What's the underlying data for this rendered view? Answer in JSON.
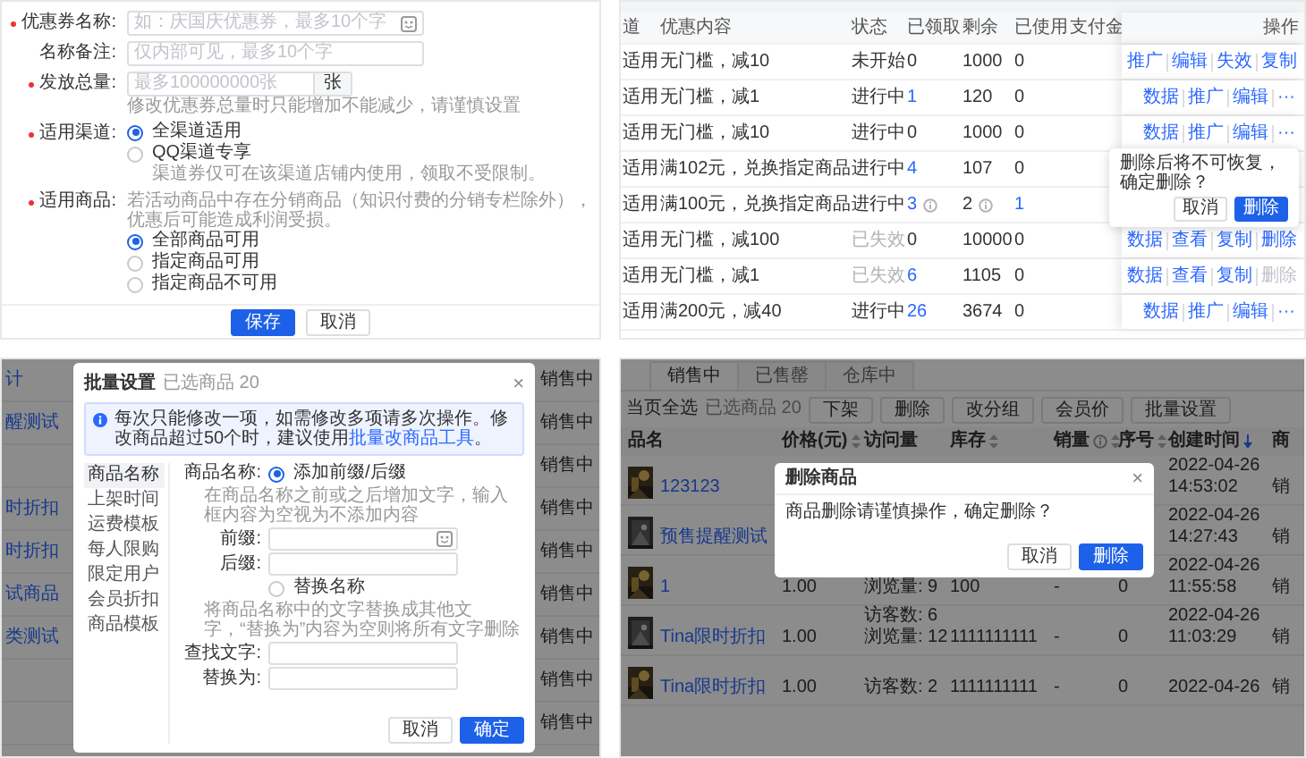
{
  "coupon_form": {
    "fields": [
      {
        "kind": "input",
        "label": "优惠券名称:",
        "required": true,
        "placeholder": "如：庆国庆优惠券，最多10个字",
        "emoji": true
      },
      {
        "kind": "input",
        "label": "名称备注:",
        "required": false,
        "placeholder": "仅内部可见，最多10个字",
        "emoji": false
      },
      {
        "kind": "addon_input",
        "label": "发放总量:",
        "required": true,
        "placeholder": "最多100000000张",
        "addon": "张",
        "hint": "修改优惠券总量时只能增加不能减少，请谨慎设置"
      },
      {
        "kind": "radio",
        "label": "适用渠道:",
        "required": true,
        "options": [
          {
            "label": "全渠道适用",
            "selected": true
          },
          {
            "label": "QQ渠道专享",
            "selected": false,
            "hint": "渠道券仅可在该渠道店铺内使用，领取不受限制。"
          }
        ]
      },
      {
        "kind": "radio",
        "label": "适用商品:",
        "required": true,
        "hint": "若活动商品中存在分销商品（知识付费的分销专栏除外），优惠后可能造成利润受损。",
        "options": [
          {
            "label": "全部商品可用",
            "selected": true
          },
          {
            "label": "指定商品可用",
            "selected": false
          },
          {
            "label": "指定商品不可用",
            "selected": false
          }
        ]
      }
    ],
    "buttons": [
      {
        "label": "保存",
        "primary": true
      },
      {
        "label": "取消",
        "primary": false
      }
    ]
  },
  "coupon_table": {
    "columns": [
      "道",
      "优惠内容",
      "状态",
      "已领取",
      "剩余",
      "已使用",
      "支付金",
      "操作"
    ],
    "rows": [
      {
        "cells": [
          {
            "kind": "plain",
            "text": "适用"
          },
          {
            "kind": "plain",
            "text": "无门槛，减10"
          },
          {
            "kind": "plain",
            "text": "未开始"
          },
          {
            "kind": "plain",
            "text": "0"
          },
          {
            "kind": "plain",
            "text": "1000"
          },
          {
            "kind": "plain",
            "text": "0"
          }
        ],
        "actions": [
          {
            "label": "推广",
            "disabled": false
          },
          {
            "label": "编辑",
            "disabled": false
          },
          {
            "label": "失效",
            "disabled": false
          },
          {
            "label": "复制",
            "disabled": false
          }
        ]
      },
      {
        "cells": [
          {
            "kind": "plain",
            "text": "适用"
          },
          {
            "kind": "plain",
            "text": "无门槛，减1"
          },
          {
            "kind": "plain",
            "text": "进行中"
          },
          {
            "kind": "link",
            "text": "1"
          },
          {
            "kind": "plain",
            "text": "120"
          },
          {
            "kind": "plain",
            "text": "0"
          }
        ],
        "actions": [
          {
            "label": "数据",
            "disabled": false
          },
          {
            "label": "推广",
            "disabled": false
          },
          {
            "label": "编辑",
            "disabled": false
          },
          {
            "label": "···",
            "disabled": false
          }
        ]
      },
      {
        "cells": [
          {
            "kind": "plain",
            "text": "适用"
          },
          {
            "kind": "plain",
            "text": "无门槛，减10"
          },
          {
            "kind": "plain",
            "text": "进行中"
          },
          {
            "kind": "plain",
            "text": "0"
          },
          {
            "kind": "plain",
            "text": "1000"
          },
          {
            "kind": "plain",
            "text": "0"
          }
        ],
        "actions": [
          {
            "label": "数据",
            "disabled": false
          },
          {
            "label": "推广",
            "disabled": false
          },
          {
            "label": "编辑",
            "disabled": false
          },
          {
            "label": "···",
            "disabled": false
          }
        ]
      },
      {
        "cells": [
          {
            "kind": "plain",
            "text": "适用"
          },
          {
            "kind": "plain",
            "text": "满102元，兑换指定商品"
          },
          {
            "kind": "plain",
            "text": "进行中"
          },
          {
            "kind": "link",
            "text": "4"
          },
          {
            "kind": "plain",
            "text": "107"
          },
          {
            "kind": "plain",
            "text": "0"
          }
        ]
      },
      {
        "cells": [
          {
            "kind": "plain",
            "text": "适用"
          },
          {
            "kind": "plain",
            "text": "满100元，兑换指定商品"
          },
          {
            "kind": "plain",
            "text": "进行中"
          },
          {
            "kind": "link_info",
            "text": "3"
          },
          {
            "kind": "plain_info",
            "text": "2"
          },
          {
            "kind": "link",
            "text": "1"
          }
        ]
      },
      {
        "cells": [
          {
            "kind": "plain",
            "text": "适用"
          },
          {
            "kind": "plain",
            "text": "无门槛，减100"
          },
          {
            "kind": "muted",
            "text": "已失效"
          },
          {
            "kind": "plain",
            "text": "0"
          },
          {
            "kind": "plain",
            "text": "10000"
          },
          {
            "kind": "plain",
            "text": "0"
          }
        ],
        "actions": [
          {
            "label": "数据",
            "disabled": false
          },
          {
            "label": "查看",
            "disabled": false
          },
          {
            "label": "复制",
            "disabled": false
          },
          {
            "label": "删除",
            "disabled": false
          }
        ]
      },
      {
        "cells": [
          {
            "kind": "plain",
            "text": "适用"
          },
          {
            "kind": "plain",
            "text": "无门槛，减1"
          },
          {
            "kind": "muted",
            "text": "已失效"
          },
          {
            "kind": "link",
            "text": "6"
          },
          {
            "kind": "plain",
            "text": "1105"
          },
          {
            "kind": "plain",
            "text": "0"
          }
        ],
        "actions": [
          {
            "label": "数据",
            "disabled": false
          },
          {
            "label": "查看",
            "disabled": false
          },
          {
            "label": "复制",
            "disabled": false
          },
          {
            "label": "删除",
            "disabled": true
          }
        ]
      },
      {
        "cells": [
          {
            "kind": "plain",
            "text": "适用"
          },
          {
            "kind": "plain",
            "text": "满200元，减40"
          },
          {
            "kind": "plain",
            "text": "进行中"
          },
          {
            "kind": "link",
            "text": "26"
          },
          {
            "kind": "plain",
            "text": "3674"
          },
          {
            "kind": "plain",
            "text": "0"
          }
        ],
        "actions": [
          {
            "label": "数据",
            "disabled": false
          },
          {
            "label": "推广",
            "disabled": false
          },
          {
            "label": "编辑",
            "disabled": false
          },
          {
            "label": "···",
            "disabled": false
          }
        ]
      }
    ],
    "popconfirm": {
      "message": "删除后将不可恢复，确定删除？",
      "buttons": [
        {
          "label": "取消",
          "primary": false
        },
        {
          "label": "删除",
          "primary": true
        }
      ]
    }
  },
  "batch_panel": {
    "background_rows": [
      {
        "name": "计",
        "status": "销售中"
      },
      {
        "name": "醒测试",
        "status": "销售中"
      },
      {
        "status": "销售中"
      },
      {
        "name": "时折扣",
        "status": "销售中"
      },
      {
        "name": "时折扣",
        "status": "销售中"
      },
      {
        "name": "试商品",
        "status": "销售中"
      },
      {
        "name": "类测试",
        "status": "销售中"
      },
      {
        "status": "销售中"
      },
      {
        "status": "销售中"
      }
    ],
    "modal": {
      "title": "批量设置",
      "subtitle": "已选商品 20",
      "close": "×",
      "info": {
        "text": "每次只能修改一项，如需修改多项请多次操作。修改商品超过50个时，建议使用",
        "link": "批量改商品工具",
        "after": "。"
      },
      "menu": [
        {
          "label": "商品名称",
          "selected": true
        },
        {
          "label": "上架时间",
          "selected": false
        },
        {
          "label": "运费模板",
          "selected": false
        },
        {
          "label": "每人限购",
          "selected": false
        },
        {
          "label": "限定用户",
          "selected": false
        },
        {
          "label": "会员折扣",
          "selected": false
        },
        {
          "label": "商品模板",
          "selected": false
        }
      ],
      "form": [
        {
          "kind": "radio",
          "label": "商品名称:",
          "option": "添加前缀/后缀",
          "selected": true,
          "hint": "在商品名称之前或之后增加文字，输入框内容为空视为不添加内容"
        },
        {
          "kind": "input",
          "label": "前缀:",
          "emoji": true
        },
        {
          "kind": "input",
          "label": "后缀:",
          "emoji": false
        },
        {
          "kind": "radio",
          "option": "替换名称",
          "selected": false,
          "hint": "将商品名称中的文字替换成其他文字，“替换为”内容为空则将所有文字删除"
        },
        {
          "kind": "input",
          "label": "查找文字:",
          "emoji": false
        },
        {
          "kind": "input",
          "label": "替换为:",
          "emoji": false
        }
      ],
      "buttons": [
        {
          "label": "取消",
          "primary": false
        },
        {
          "label": "确定",
          "primary": true
        }
      ]
    }
  },
  "product_panel": {
    "tabs": [
      {
        "label": "销售中",
        "selected": true
      },
      {
        "label": "已售罄",
        "selected": false
      },
      {
        "label": "仓库中",
        "selected": false
      }
    ],
    "toolbar": {
      "select_all": "当页全选",
      "selected_count": "已选商品 20",
      "buttons": [
        "下架",
        "删除",
        "改分组",
        "会员价",
        "批量设置"
      ]
    },
    "columns": [
      {
        "label": "品名",
        "sortable": false,
        "sorted": false,
        "info": false
      },
      {
        "label": "价格(元)",
        "sortable": true,
        "sorted": false,
        "info": false
      },
      {
        "label": "访问量",
        "sortable": false,
        "sorted": false,
        "info": false
      },
      {
        "label": "库存",
        "sortable": true,
        "sorted": false,
        "info": false
      },
      {
        "label": "销量",
        "sortable": true,
        "sorted": false,
        "info": true
      },
      {
        "label": "序号",
        "sortable": true,
        "sorted": false,
        "info": false
      },
      {
        "label": "创建时间",
        "sortable": false,
        "sorted": true,
        "info": false
      },
      {
        "label": "商",
        "sortable": false,
        "sorted": false,
        "info": false
      }
    ],
    "rows": [
      {
        "name": "123123",
        "created": [
          "2022-04-26",
          "14:53:02"
        ],
        "status": "销"
      },
      {
        "name": "预售提醒测试",
        "created": [
          "2022-04-26",
          "14:27:43"
        ],
        "status": "销"
      },
      {
        "name": "1",
        "price": "1.00",
        "visits": [
          "浏览量: 9"
        ],
        "stock": "100",
        "sales": "-",
        "seq": "0",
        "created": [
          "2022-04-26",
          "11:55:58"
        ],
        "status": "销"
      },
      {
        "name": "Tina限时折扣",
        "price": "1.00",
        "visits": [
          "访客数: 6",
          "浏览量: 12"
        ],
        "stock": "1111111111",
        "sales": "-",
        "seq": "0",
        "created": [
          "2022-04-26",
          "11:03:29"
        ],
        "status": "销"
      },
      {
        "name": "Tina限时折扣",
        "price": "1.00",
        "visits": [
          "访客数: 2"
        ],
        "stock": "1111111111",
        "sales": "-",
        "seq": "0",
        "created": [
          "2022-04-26"
        ],
        "status": "销"
      }
    ],
    "dialog": {
      "title": "删除商品",
      "close": "×",
      "message": "商品删除请谨慎操作，确定删除？",
      "buttons": [
        {
          "label": "取消",
          "primary": false
        },
        {
          "label": "删除",
          "primary": true
        }
      ]
    }
  }
}
